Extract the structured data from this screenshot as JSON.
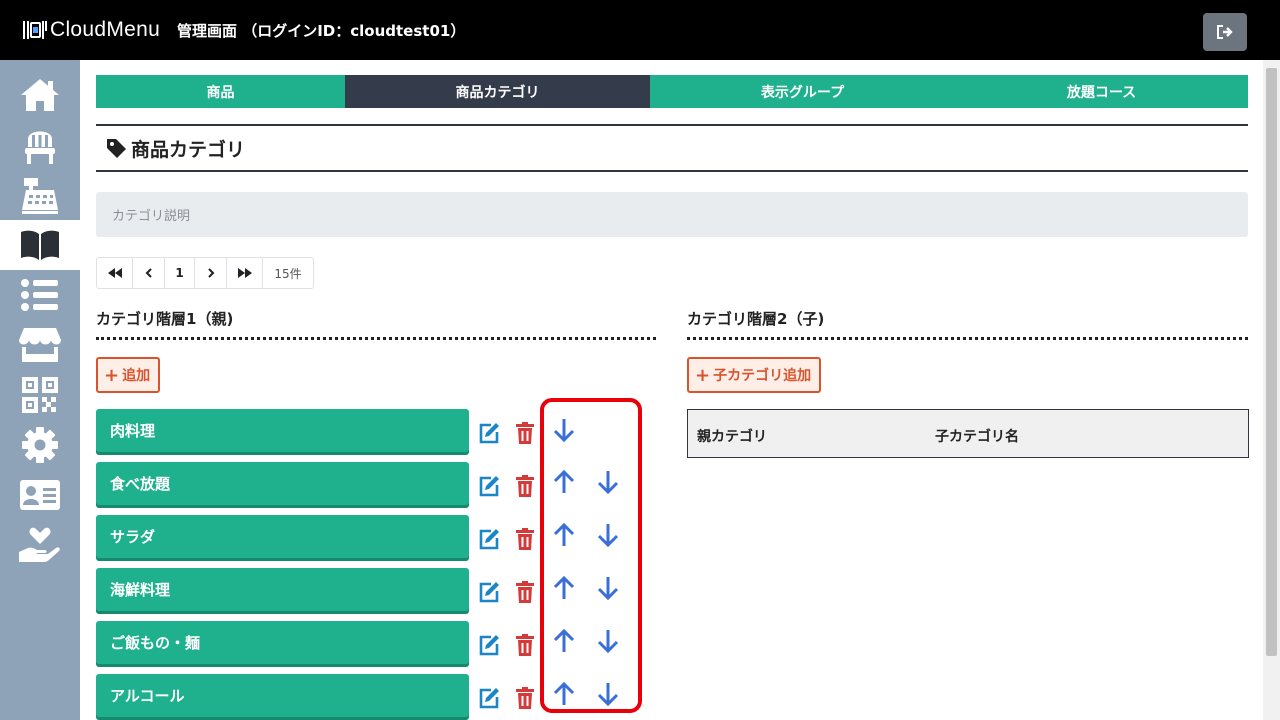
{
  "header": {
    "logo_text": "CloudMenu",
    "title": "管理画面 （ログインID：cloudtest01）",
    "logout_icon": "logout-icon"
  },
  "sidebar": {
    "items": [
      {
        "icon": "home-icon",
        "active": false
      },
      {
        "icon": "chair-icon",
        "active": false
      },
      {
        "icon": "cash-register-icon",
        "active": false
      },
      {
        "icon": "book-open-icon",
        "active": true
      },
      {
        "icon": "list-icon",
        "active": false
      },
      {
        "icon": "store-icon",
        "active": false
      },
      {
        "icon": "qrcode-icon",
        "active": false
      },
      {
        "icon": "gear-icon",
        "active": false
      },
      {
        "icon": "id-card-icon",
        "active": false
      },
      {
        "icon": "hand-heart-icon",
        "active": false
      }
    ]
  },
  "tabs": [
    {
      "label": "商品",
      "active": false
    },
    {
      "label": "商品カテゴリ",
      "active": true
    },
    {
      "label": "表示グループ",
      "active": false
    },
    {
      "label": "放題コース",
      "active": false
    }
  ],
  "page_title": "商品カテゴリ",
  "description_placeholder": "カテゴリ説明",
  "pagination": {
    "first": "«",
    "prev": "‹",
    "page": "1",
    "next": "›",
    "last": "»",
    "count": "15件"
  },
  "parent_section": {
    "title": "カテゴリ階層1（親)",
    "add_label": "追加",
    "categories": [
      "肉料理",
      "食べ放題",
      "サラダ",
      "海鮮料理",
      "ご飯もの・麺",
      "アルコール"
    ]
  },
  "child_section": {
    "title": "カテゴリ階層2（子)",
    "add_label": "子カテゴリ追加",
    "col_parent": "親カテゴリ",
    "col_child": "子カテゴリ名"
  },
  "colors": {
    "accent": "#1fb08d",
    "tab_active": "#343b4a",
    "danger": "#d9532c",
    "highlight": "#e8000b",
    "arrow": "#3b6fd8",
    "edit": "#1a86c7",
    "delete": "#d33a3a"
  }
}
